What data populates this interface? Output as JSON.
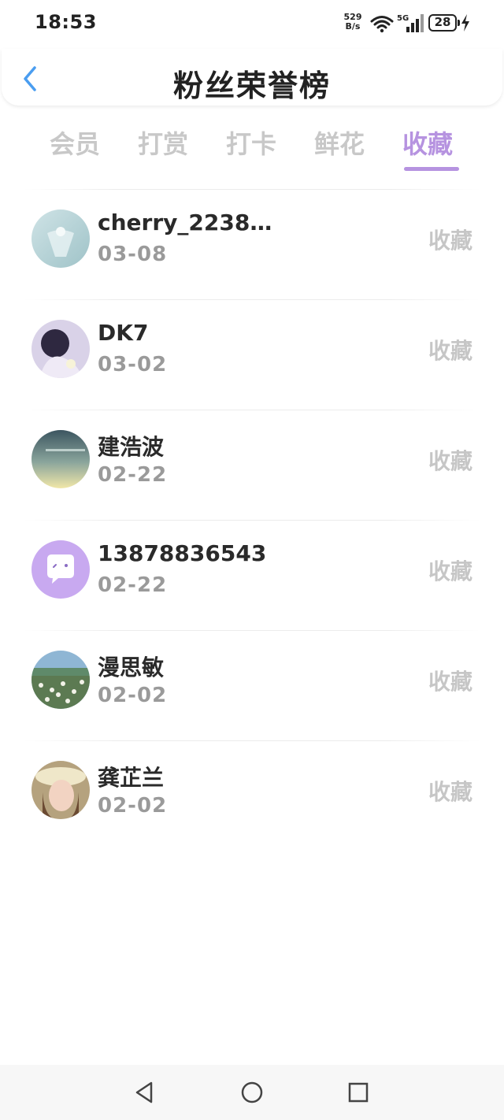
{
  "status_bar": {
    "time": "18:53",
    "net_speed_value": "529",
    "net_speed_unit": "B/s",
    "signal_label": "5G",
    "battery": "28"
  },
  "header": {
    "title": "粉丝荣誉榜",
    "back_icon": "chevron-left-icon"
  },
  "tabs": [
    {
      "label": "会员",
      "active": false
    },
    {
      "label": "打赏",
      "active": false
    },
    {
      "label": "打卡",
      "active": false
    },
    {
      "label": "鲜花",
      "active": false
    },
    {
      "label": "收藏",
      "active": true
    }
  ],
  "list": [
    {
      "name": "cherry_22384...",
      "date": "03-08",
      "action": "收藏"
    },
    {
      "name": "DK7",
      "date": "03-02",
      "action": "收藏"
    },
    {
      "name": "建浩波",
      "date": "02-22",
      "action": "收藏"
    },
    {
      "name": "13878836543",
      "date": "02-22",
      "action": "收藏"
    },
    {
      "name": "漫思敏",
      "date": "02-02",
      "action": "收藏"
    },
    {
      "name": "龚芷兰",
      "date": "02-02",
      "action": "收藏"
    }
  ],
  "colors": {
    "accent": "#b693e0",
    "inactive_tab": "#c8c8c8",
    "back_arrow": "#4a9df0"
  }
}
